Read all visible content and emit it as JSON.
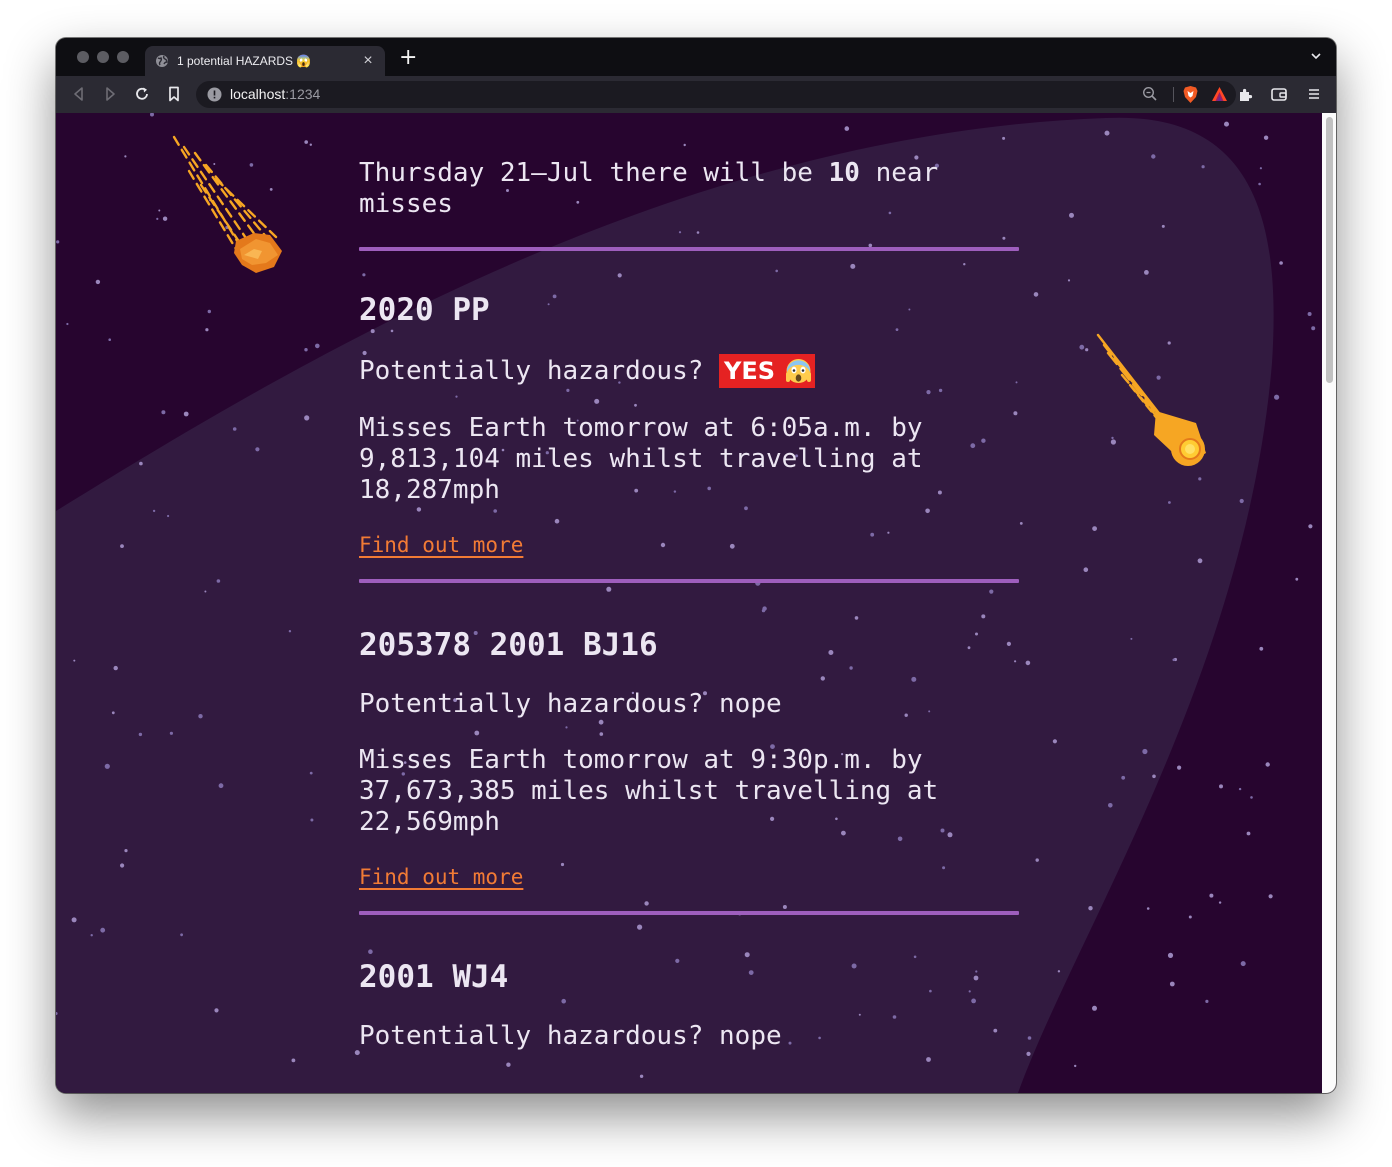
{
  "browser": {
    "tab_title": "1 potential HAZARDS 😱",
    "url_host": "localhost",
    "url_port": ":1234"
  },
  "page": {
    "intro_prefix": "Thursday 21–Jul there will be",
    "intro_count": "10",
    "intro_suffix_line1": "near",
    "intro_suffix_line2": "misses",
    "hazard_label": "Potentially hazardous?",
    "link_label": "Find out more",
    "asteroids": [
      {
        "name": "2020 PP",
        "hazardous": "YES",
        "miss_line1": "Misses Earth tomorrow at 6:05a.m. by",
        "miss_line2": "9,813,104 miles whilst travelling at",
        "miss_line3": "18,287mph"
      },
      {
        "name": "205378 2001 BJ16",
        "hazardous": "nope",
        "miss_line1": "Misses Earth tomorrow at 9:30p.m. by",
        "miss_line2": "37,673,385 miles whilst travelling at",
        "miss_line3": "22,569mph"
      },
      {
        "name": "2001 WJ4",
        "hazardous": "nope"
      }
    ]
  },
  "colors": {
    "background": "#27052f",
    "planet_glow": "#321a40",
    "divider": "#9e5ebd",
    "link": "#f27b35",
    "hazard_badge": "#e52222",
    "meteor": "#f6a623"
  },
  "icons": [
    "globe-icon",
    "close-icon",
    "plus-icon",
    "chevron-down-icon",
    "back-icon",
    "forward-icon",
    "reload-icon",
    "bookmark-icon",
    "info-icon",
    "zoom-icon",
    "brave-shield-icon",
    "brave-rewards-icon",
    "extensions-icon",
    "wallet-icon",
    "menu-icon",
    "scream-emoji-icon",
    "meteor-icon"
  ]
}
